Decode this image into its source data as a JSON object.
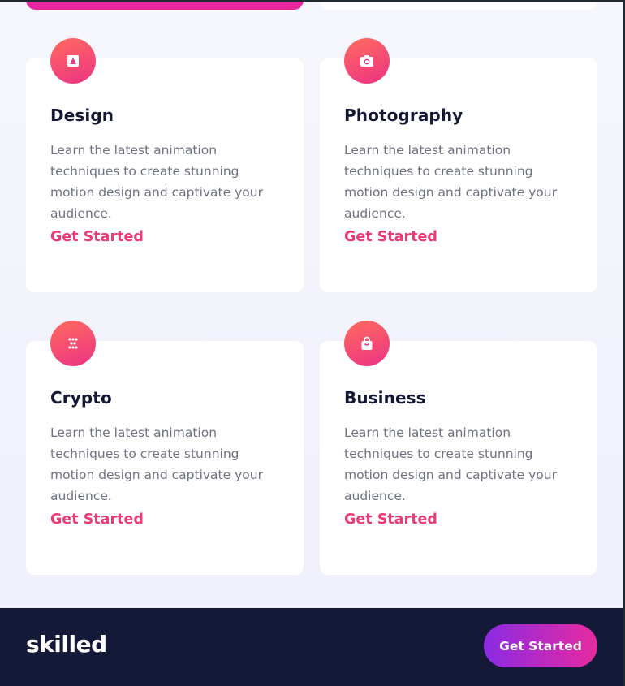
{
  "cards": [
    {
      "title": "Design",
      "icon": "design-icon",
      "description": "Learn the latest animation techniques to create stunning motion design and captivate your audience.",
      "link": "Get Started"
    },
    {
      "title": "Photography",
      "icon": "camera-icon",
      "description": "Learn the latest animation techniques to create stunning motion design and captivate your audience.",
      "link": "Get Started"
    },
    {
      "title": "Crypto",
      "icon": "crypto-icon",
      "description": "Learn the latest animation techniques to create stunning motion design and captivate your audience.",
      "link": "Get Started"
    },
    {
      "title": "Business",
      "icon": "shopping-bag-icon",
      "description": "Learn the latest animation techniques to create stunning motion design and captivate your audience.",
      "link": "Get Started"
    }
  ],
  "footer": {
    "logo": "skilled",
    "cta_label": "Get Started"
  },
  "colors": {
    "accent": "#ec3a77",
    "footer_bg": "#141937",
    "heading": "#141834"
  }
}
